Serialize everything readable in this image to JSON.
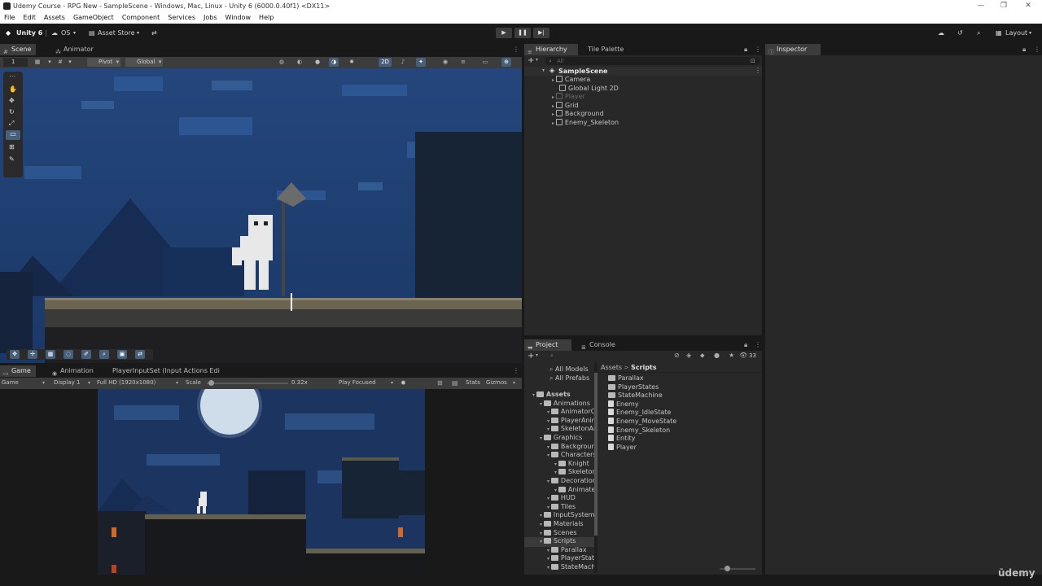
{
  "window": {
    "title": "Udemy Course - RPG New - SampleScene - Windows, Mac, Linux - Unity 6 (6000.0.40f1) <DX11>",
    "controls": [
      "—",
      "❐",
      "✕"
    ]
  },
  "menu": [
    "File",
    "Edit",
    "Assets",
    "GameObject",
    "Component",
    "Services",
    "Jobs",
    "Window",
    "Help"
  ],
  "toolbar": {
    "unity_label": "Unity 6",
    "os_label": "OS",
    "asset_store_label": "Asset Store",
    "layout_label": "Layout"
  },
  "scene_view": {
    "tabs": [
      "Scene",
      "Animator"
    ],
    "layer_value": "1",
    "pivot_label": "Pivot",
    "global_label": "Global",
    "mode_2d": "2D"
  },
  "game_view": {
    "tabs": [
      "Game",
      "Animation"
    ],
    "asset_label": "PlayerInputSet (Input Actions Edi",
    "game_dropdown": "Game",
    "display_dropdown": "Display 1",
    "resolution_dropdown": "Full HD (1920x1080)",
    "scale_label": "Scale",
    "scale_value": "0.32x",
    "scale_fraction": 0.02,
    "play_mode_dropdown": "Play Focused",
    "stats_label": "Stats",
    "gizmos_label": "Gizmos"
  },
  "hierarchy": {
    "tabs": [
      "Hierarchy",
      "Tile Palette"
    ],
    "search_placeholder": "All",
    "scene_name": "SampleScene",
    "items": [
      "Camera",
      "Global Light 2D",
      "Player",
      "Grid",
      "Background",
      "Enemy_Skeleton"
    ]
  },
  "inspector": {
    "tab": "Inspector"
  },
  "project": {
    "tabs": [
      "Project",
      "Console"
    ],
    "badge_count": "33",
    "favorites": [
      "All Models",
      "All Prefabs"
    ],
    "tree": [
      {
        "label": "Assets",
        "depth": 0,
        "bold": true
      },
      {
        "label": "Animations",
        "depth": 1
      },
      {
        "label": "AnimatorC",
        "depth": 2
      },
      {
        "label": "PlayerAnim",
        "depth": 2
      },
      {
        "label": "SkeletonAr",
        "depth": 2
      },
      {
        "label": "Graphics",
        "depth": 1
      },
      {
        "label": "Backgroun",
        "depth": 2
      },
      {
        "label": "Characters",
        "depth": 2
      },
      {
        "label": "Knight",
        "depth": 3
      },
      {
        "label": "Skeleton",
        "depth": 3
      },
      {
        "label": "Decoration",
        "depth": 2
      },
      {
        "label": "Animate",
        "depth": 3
      },
      {
        "label": "HUD",
        "depth": 2
      },
      {
        "label": "Tiles",
        "depth": 2
      },
      {
        "label": "InputSystem",
        "depth": 1
      },
      {
        "label": "Materials",
        "depth": 1
      },
      {
        "label": "Scenes",
        "depth": 1
      },
      {
        "label": "Scripts",
        "depth": 1,
        "selected": true
      },
      {
        "label": "Parallax",
        "depth": 2
      },
      {
        "label": "PlayerStat",
        "depth": 2
      },
      {
        "label": "StateMach",
        "depth": 2
      }
    ],
    "breadcrumb": [
      "Assets",
      "Scripts"
    ],
    "files": [
      {
        "label": "Parallax",
        "kind": "folder"
      },
      {
        "label": "PlayerStates",
        "kind": "folder"
      },
      {
        "label": "StateMachine",
        "kind": "folder"
      },
      {
        "label": "Enemy",
        "kind": "script"
      },
      {
        "label": "Enemy_IdleState",
        "kind": "script"
      },
      {
        "label": "Enemy_MoveState",
        "kind": "script"
      },
      {
        "label": "Enemy_Skeleton",
        "kind": "script"
      },
      {
        "label": "Entity",
        "kind": "script"
      },
      {
        "label": "Player",
        "kind": "script"
      }
    ]
  },
  "watermark": "ūdemy"
}
